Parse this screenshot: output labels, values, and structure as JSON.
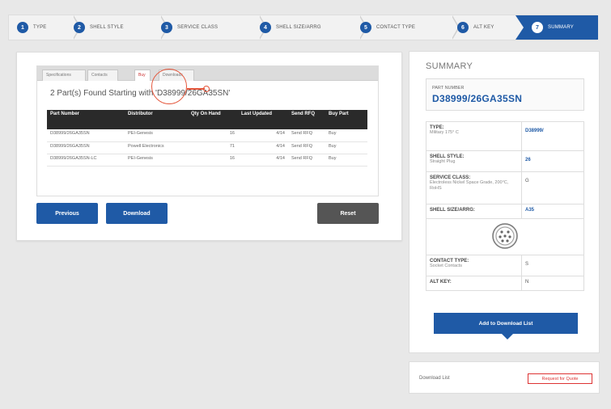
{
  "steps": [
    {
      "num": "1",
      "label": "TYPE"
    },
    {
      "num": "2",
      "label": "SHELL STYLE"
    },
    {
      "num": "3",
      "label": "SERVICE CLASS"
    },
    {
      "num": "4",
      "label": "SHELL SIZE/ARRG"
    },
    {
      "num": "5",
      "label": "CONTACT TYPE"
    },
    {
      "num": "6",
      "label": "ALT KEY"
    },
    {
      "num": "7",
      "label": "SUMMARY"
    }
  ],
  "tabs": [
    "Specifications",
    "Contacts",
    "Buy",
    "Downloads"
  ],
  "results": {
    "found_text": "2 Part(s) Found Starting with 'D38999/26GA35SN'",
    "headers": [
      "Part Number",
      "Distributor",
      "Qty On Hand",
      "Last Updated",
      "Send RFQ",
      "Buy Part"
    ],
    "rows": [
      [
        "D38999/26GA35SN",
        "PEI-Genesis",
        "16",
        "4/14",
        "Send RFQ",
        "Buy"
      ],
      [
        "D38999/26GA35SN",
        "Powell Electronics",
        "71",
        "4/14",
        "Send RFQ",
        "Buy"
      ],
      [
        "D38999/26GA35SN-LC",
        "PEI-Genesis",
        "16",
        "4/14",
        "Send RFQ",
        "Buy"
      ]
    ]
  },
  "buttons": {
    "previous": "Previous",
    "download": "Download",
    "reset": "Reset"
  },
  "summary": {
    "title": "SUMMARY",
    "part_label": "PART NUMBER",
    "part_number": "D38999/26GA35SN",
    "rows": [
      {
        "label": "TYPE:",
        "sub": "Military 175° C",
        "value": "D38999/"
      },
      {
        "label": "SHELL STYLE:",
        "sub": "Straight Plug",
        "value": "26"
      },
      {
        "label": "SERVICE CLASS:",
        "sub": "Electroless Nickel Space Grade, 200°C, RoHS",
        "value": "G"
      },
      {
        "label": "SHELL SIZE/ARRG:",
        "sub": "",
        "value": "A35"
      },
      {
        "label": "CONTACT TYPE:",
        "sub": "Socket Contacts",
        "value": "S"
      },
      {
        "label": "ALT KEY:",
        "sub": "",
        "value": "N"
      }
    ],
    "add_button": "Add to Download List"
  },
  "download_list": {
    "label": "Download List",
    "quote_button": "Request for Quote"
  },
  "colors": {
    "accent": "#1f5aa6",
    "highlight": "#e4553a",
    "table_header": "#2a2a2a"
  }
}
